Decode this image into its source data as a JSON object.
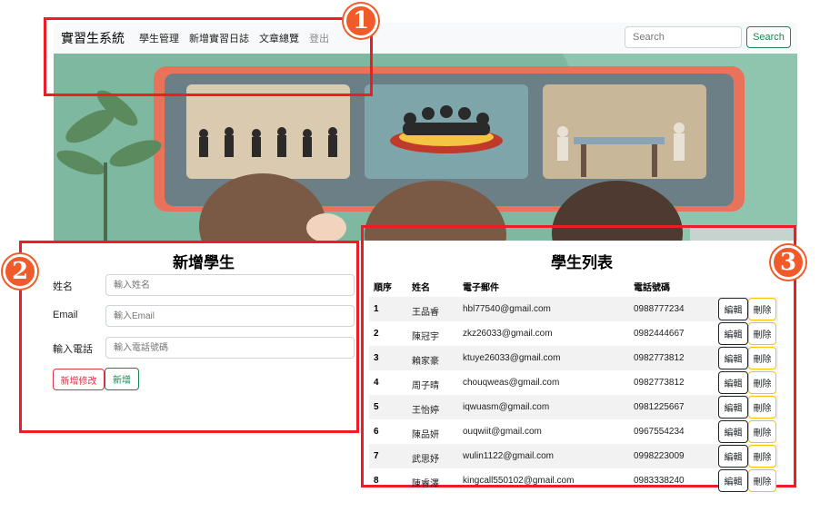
{
  "navbar": {
    "brand": "實習生系統",
    "links": [
      "學生管理",
      "新增實習日誌",
      "文章總覽",
      "登出"
    ],
    "search_placeholder": "Search",
    "search_button": "Search"
  },
  "annotations": {
    "badge_1": "1",
    "badge_2": "2",
    "badge_3": "3",
    "color": "#ee1c24"
  },
  "form": {
    "title": "新增學生",
    "fields": [
      {
        "label": "姓名",
        "placeholder": "輸入姓名"
      },
      {
        "label": "Email",
        "placeholder": "輸入Email"
      },
      {
        "label": "輸入電話",
        "placeholder": "輸入電話號碼"
      }
    ],
    "btn_update": "新增修改",
    "btn_add": "新增"
  },
  "table": {
    "title": "學生列表",
    "headers": [
      "順序",
      "姓名",
      "電子郵件",
      "電話號碼"
    ],
    "edit_label": "編輯",
    "delete_label": "刪除",
    "rows": [
      {
        "no": "1",
        "name": "王品睿",
        "email": "hbl77540@gmail.com",
        "phone": "0988777234"
      },
      {
        "no": "2",
        "name": "陳冠宇",
        "email": "zkz26033@gmail.com",
        "phone": "0982444667"
      },
      {
        "no": "3",
        "name": "賴家豪",
        "email": "ktuye26033@gmail.com",
        "phone": "0982773812"
      },
      {
        "no": "4",
        "name": "周子晴",
        "email": "chouqweas@gmail.com",
        "phone": "0982773812"
      },
      {
        "no": "5",
        "name": "王怡婷",
        "email": "iqwuasm@gmail.com",
        "phone": "0981225667"
      },
      {
        "no": "6",
        "name": "陳品妍",
        "email": "ouqwiit@gmail.com",
        "phone": "0967554234"
      },
      {
        "no": "7",
        "name": "武思妤",
        "email": "wulin1122@gmail.com",
        "phone": "0998223009"
      },
      {
        "no": "8",
        "name": "陳睿澤",
        "email": "kingcall550102@gmail.com",
        "phone": "0983338240"
      }
    ]
  },
  "colors": {
    "accent_success": "#198754",
    "accent_danger": "#dc3545",
    "accent_warning": "#ffc107",
    "badge": "#f15a29"
  }
}
